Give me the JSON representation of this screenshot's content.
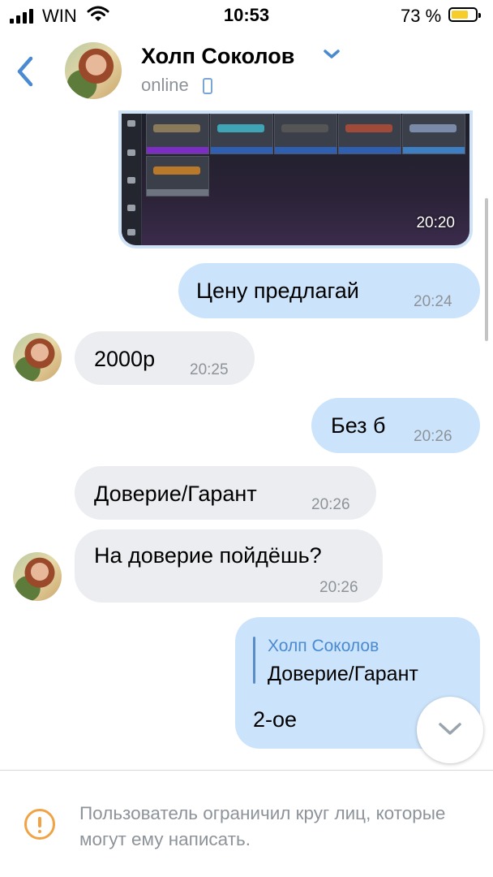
{
  "status_bar": {
    "carrier": "WIN",
    "time": "10:53",
    "battery_percent": "73 %",
    "battery_level": 0.73,
    "battery_color": "#f7cd2a"
  },
  "header": {
    "contact_name": "Холп Соколов",
    "presence": "online",
    "icons": [
      "back-chevron-icon",
      "dropdown-chevron-icon",
      "mobile-phone-icon"
    ]
  },
  "accent_color": "#4a8ad0",
  "photo": {
    "time": "20:20"
  },
  "messages": [
    {
      "dir": "out",
      "text": "Цену предлагай",
      "time": "20:24"
    },
    {
      "dir": "in",
      "text": "2000р",
      "time": "20:25"
    },
    {
      "dir": "out",
      "text": "Без б",
      "time": "20:26"
    },
    {
      "dir": "in",
      "text": "Доверие/Гарант",
      "time": "20:26"
    },
    {
      "dir": "in",
      "text": "На доверие пойдёшь?",
      "time": "20:26"
    },
    {
      "dir": "out",
      "reply_author": "Холп Соколов",
      "reply_text": "Доверие/Гарант",
      "text": "2-ое"
    }
  ],
  "notice": {
    "icon": "warning-icon",
    "text": "Пользователь ограничил круг лиц, которые могут ему написать."
  }
}
